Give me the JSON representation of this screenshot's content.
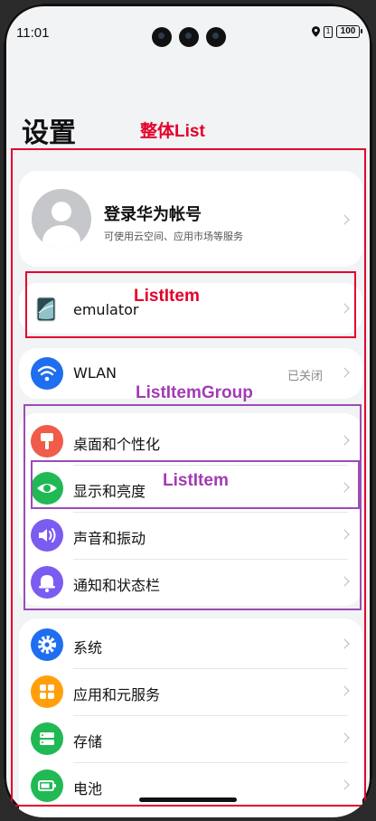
{
  "status_bar": {
    "time": "11:01",
    "sim": "1",
    "battery": "100"
  },
  "page": {
    "title": "设置"
  },
  "annotations": {
    "list": "整体List",
    "list_item": "ListItem",
    "list_item_group": "ListItemGroup",
    "list_item_inner": "ListItem"
  },
  "account": {
    "title": "登录华为帐号",
    "subtitle": "可使用云空间、应用市场等服务"
  },
  "device": {
    "name": "emulator"
  },
  "wlan": {
    "label": "WLAN",
    "value": "已关闭"
  },
  "group": {
    "items": [
      {
        "label": "桌面和个性化",
        "icon": "paint-brush-icon",
        "color": "#f05b4a"
      },
      {
        "label": "显示和亮度",
        "icon": "eye-icon",
        "color": "#20b954"
      },
      {
        "label": "声音和振动",
        "icon": "speaker-icon",
        "color": "#7b5cf0"
      },
      {
        "label": "通知和状态栏",
        "icon": "bell-icon",
        "color": "#7b5cf0"
      }
    ]
  },
  "system": {
    "items": [
      {
        "label": "系统",
        "icon": "gear-icon",
        "color": "#1f6ef0"
      },
      {
        "label": "应用和元服务",
        "icon": "apps-grid-icon",
        "color": "#ff9f0a"
      },
      {
        "label": "存储",
        "icon": "storage-icon",
        "color": "#20b954"
      },
      {
        "label": "电池",
        "icon": "battery-icon",
        "color": "#20b954"
      }
    ]
  },
  "colors": {
    "annotation_red": "#e4002b",
    "annotation_purple": "#9b4cb6",
    "wlan_icon": "#1f6ef0"
  }
}
